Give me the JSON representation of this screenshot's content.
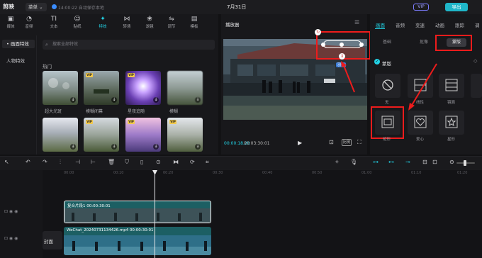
{
  "app": {
    "logo": "剪映",
    "menu": "菜单 ⌄",
    "autosave": "14:00:22 自动保存本地",
    "title": "7月31日",
    "vip": "VIP",
    "export": "导出"
  },
  "left_tabs": [
    {
      "label": "媒体",
      "icon": "▣"
    },
    {
      "label": "音频",
      "icon": "◔"
    },
    {
      "label": "文本",
      "icon": "TI"
    },
    {
      "label": "贴纸",
      "icon": "☺"
    },
    {
      "label": "特效",
      "icon": "✦"
    },
    {
      "label": "转场",
      "icon": "⋈"
    },
    {
      "label": "滤镜",
      "icon": "❀"
    },
    {
      "label": "调节",
      "icon": "⇋"
    },
    {
      "label": "模板",
      "icon": "▤"
    }
  ],
  "sidebar": {
    "items": [
      "• 画面特效",
      "人物特效"
    ]
  },
  "search": {
    "placeholder": "搜索全部特效"
  },
  "effects": {
    "section_title": "热门",
    "items": [
      {
        "label": "超大光斑"
      },
      {
        "label": "模糊闭幕"
      },
      {
        "label": "星夜追随"
      },
      {
        "label": "模糊"
      },
      {
        "label": ""
      },
      {
        "label": ""
      },
      {
        "label": ""
      },
      {
        "label": ""
      }
    ]
  },
  "player": {
    "title": "播放器",
    "time_current": "00:00:18.20",
    "time_total": "00:03:30:01",
    "ratio": "比例",
    "overlay_label": "羽化"
  },
  "right_panel": {
    "tabs": [
      "画面",
      "音频",
      "变速",
      "动画",
      "跟踪",
      "调"
    ],
    "subtabs": [
      "基础",
      "抠像",
      "蒙版"
    ],
    "mask_label": "蒙版",
    "masks": [
      {
        "label": "无"
      },
      {
        "label": "线性"
      },
      {
        "label": "镜面"
      },
      {
        "label": ""
      },
      {
        "label": "矩形"
      },
      {
        "label": "爱心"
      },
      {
        "label": "星形"
      }
    ]
  },
  "timeline": {
    "ticks": [
      "00:00",
      "00:10",
      "00:20",
      "00:30",
      "00:40",
      "00:50",
      "01:00",
      "01:10",
      "01:20"
    ],
    "clip_top_label": "复合片段1   00:00:30:01",
    "clip_bottom_label": "WeChat_20240731134426.mp4   00:00:30:01",
    "cover_label": "封面"
  },
  "colors": {
    "accent": "#22d3e6",
    "highlight": "#ee1c1c",
    "clip_bg": "#1f6f73"
  }
}
